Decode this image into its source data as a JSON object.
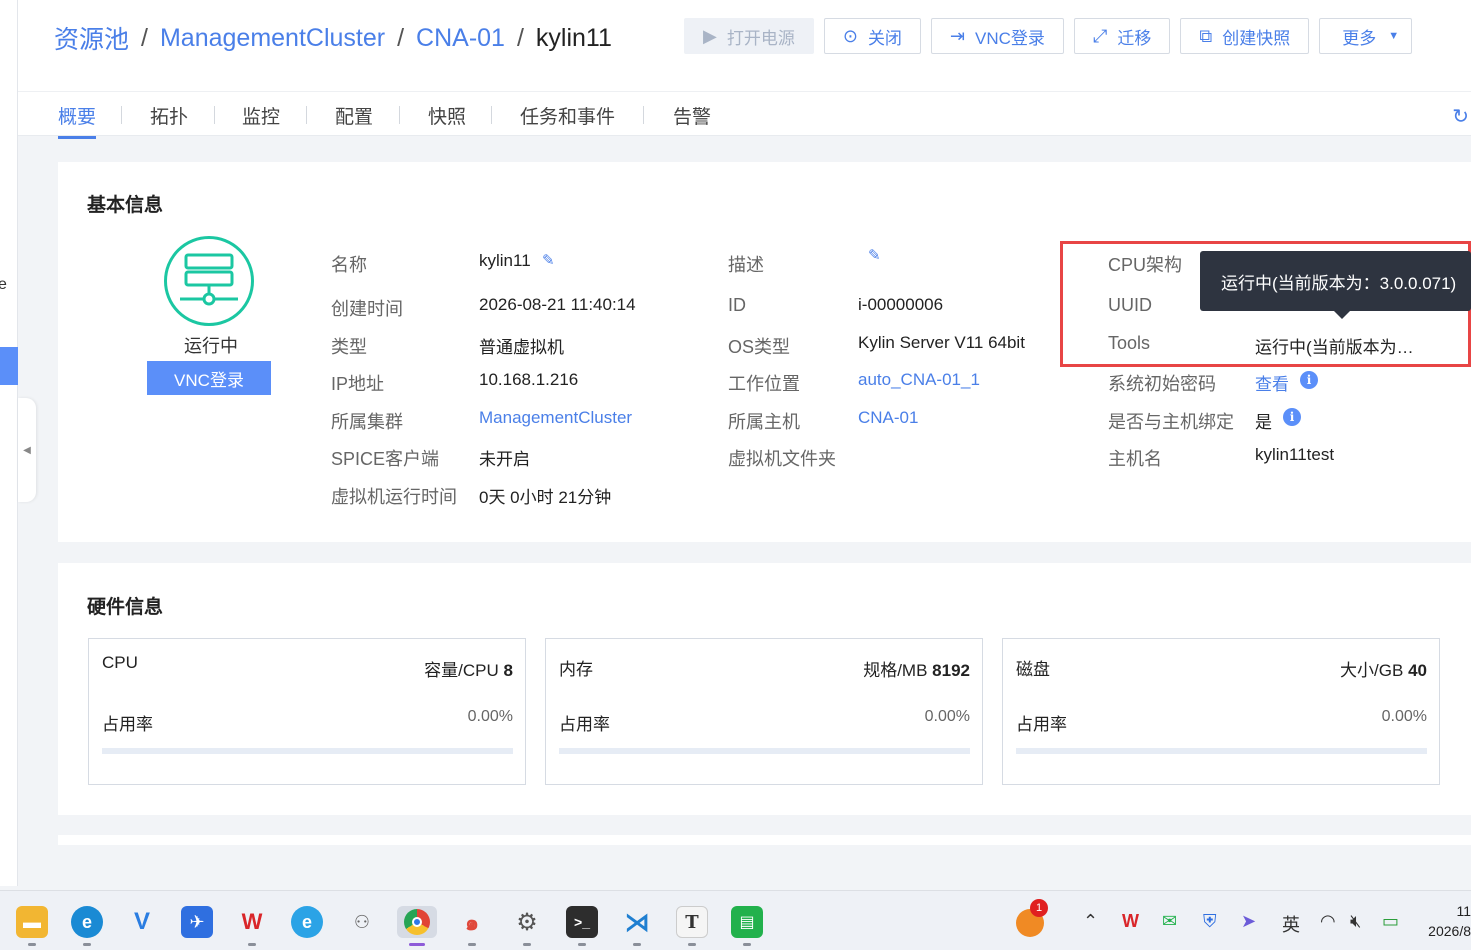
{
  "sidebar": {
    "cut_text": "e"
  },
  "breadcrumb": {
    "items": [
      "资源池",
      "ManagementCluster",
      "CNA-01",
      "kylin11"
    ],
    "separator": "/"
  },
  "toolbar": {
    "power_on": "打开电源",
    "shutdown": "关闭",
    "vnc_login": "VNC登录",
    "migrate": "迁移",
    "snapshot": "创建快照",
    "more": "更多"
  },
  "tabs": [
    "概要",
    "拓扑",
    "监控",
    "配置",
    "快照",
    "任务和事件",
    "告警"
  ],
  "basic_info": {
    "title": "基本信息",
    "status": "运行中",
    "vnc_button": "VNC登录",
    "col1": {
      "name_label": "名称",
      "name_value": "kylin11",
      "created_label": "创建时间",
      "created_value": "2026-08-21 11:40:14",
      "type_label": "类型",
      "type_value": "普通虚拟机",
      "ip_label": "IP地址",
      "ip_value": "10.168.1.216",
      "cluster_label": "所属集群",
      "cluster_value": "ManagementCluster",
      "spice_label": "SPICE客户端",
      "spice_value": "未开启",
      "uptime_label": "虚拟机运行时间",
      "uptime_value": "0天 0小时 21分钟"
    },
    "col2": {
      "desc_label": "描述",
      "id_label": "ID",
      "id_value": "i-00000006",
      "os_label": "OS类型",
      "os_value": "Kylin Server V11 64bit",
      "location_label": "工作位置",
      "location_value": "auto_CNA-01_1",
      "host_label": "所属主机",
      "host_value": "CNA-01",
      "folder_label": "虚拟机文件夹"
    },
    "col3": {
      "cpu_arch_label": "CPU架构",
      "uuid_label": "UUID",
      "tools_label": "Tools",
      "tools_value": "运行中(当前版本为…",
      "init_pwd_label": "系统初始密码",
      "init_pwd_value": "查看",
      "bind_label": "是否与主机绑定",
      "bind_value": "是",
      "hostname_label": "主机名",
      "hostname_value": "kylin11test"
    },
    "tooltip": "运行中(当前版本为：3.0.0.071)"
  },
  "hardware": {
    "title": "硬件信息",
    "usage_label": "占用率",
    "boxes": [
      {
        "name": "CPU",
        "spec_label": "容量/CPU",
        "spec_value": "8",
        "usage": "0.00%",
        "usage_fraction": 0
      },
      {
        "name": "内存",
        "spec_label": "规格/MB",
        "spec_value": "8192",
        "usage": "0.00%",
        "usage_fraction": 0
      },
      {
        "name": "磁盘",
        "spec_label": "大小/GB",
        "spec_value": "40",
        "usage": "0.00%",
        "usage_fraction": 0
      }
    ]
  },
  "taskbar": {
    "notification_count": "1",
    "ime": "英",
    "time": "11",
    "date": "2026/8"
  }
}
